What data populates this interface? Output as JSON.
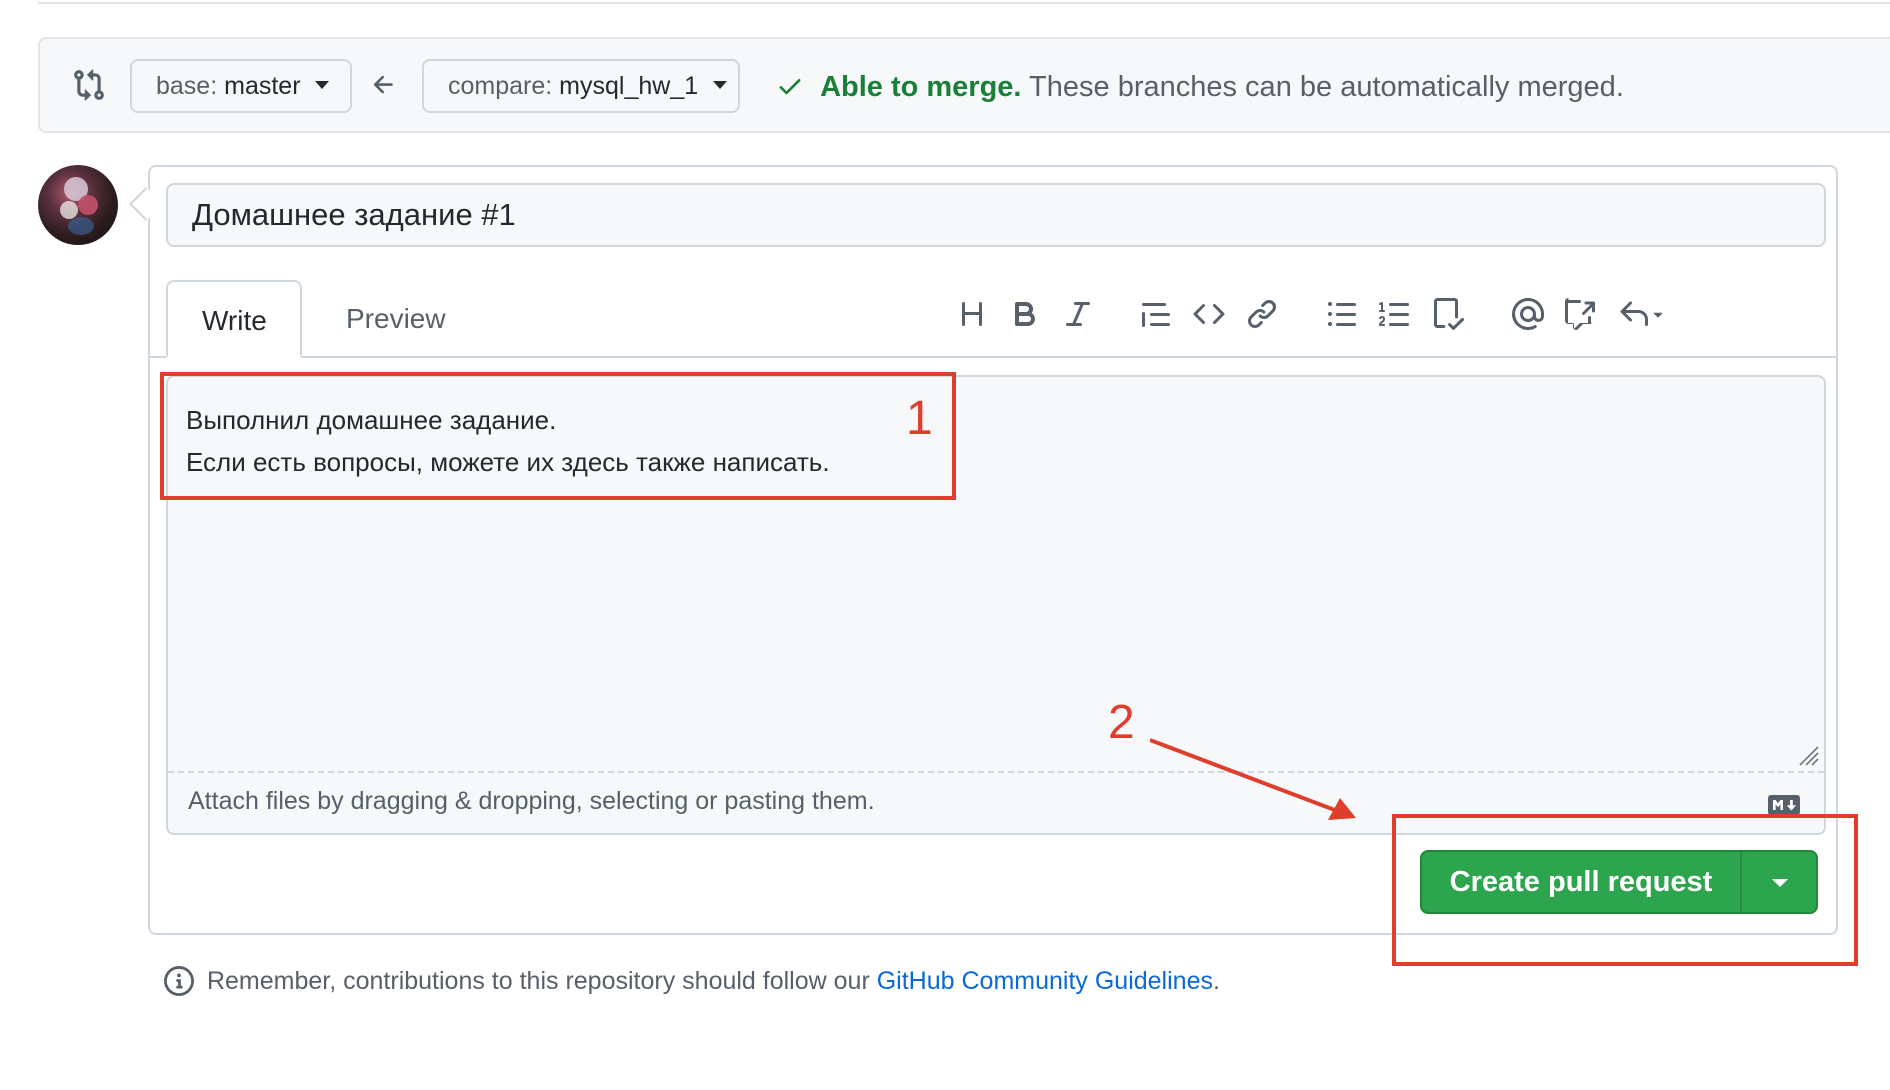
{
  "range_editor": {
    "base_prefix": "base:",
    "base_branch": "master",
    "compare_prefix": "compare:",
    "compare_branch": "mysql_hw_1",
    "merge_status": "Able to merge.",
    "merge_description": "These branches can be automatically merged."
  },
  "pr_form": {
    "title_value": "Домашнее задание #1",
    "tabs": [
      {
        "label": "Write",
        "selected": true
      },
      {
        "label": "Preview",
        "selected": false
      }
    ],
    "toolbar_icons": [
      "heading-icon",
      "bold-icon",
      "italic-icon",
      "quote-icon",
      "code-icon",
      "link-icon",
      "unordered-list-icon",
      "ordered-list-icon",
      "task-list-icon",
      "mention-icon",
      "reference-icon",
      "reply-icon"
    ],
    "body_lines": [
      "Выполнил домашнее задание.",
      "Если есть вопросы, можете их здесь также написать."
    ],
    "attach_hint": "Attach files by dragging & dropping, selecting or pasting them.",
    "submit_label": "Create pull request"
  },
  "footer": {
    "note_prefix": "Remember, contributions to this repository should follow our",
    "link_text": "GitHub Community Guidelines",
    "note_suffix": "."
  },
  "annotations": {
    "step_1": "1",
    "step_2": "2",
    "color": "#e03e2d"
  },
  "colors": {
    "success_green": "#2da44e",
    "merge_text_green": "#1a7f37",
    "link_blue": "#0969da"
  }
}
